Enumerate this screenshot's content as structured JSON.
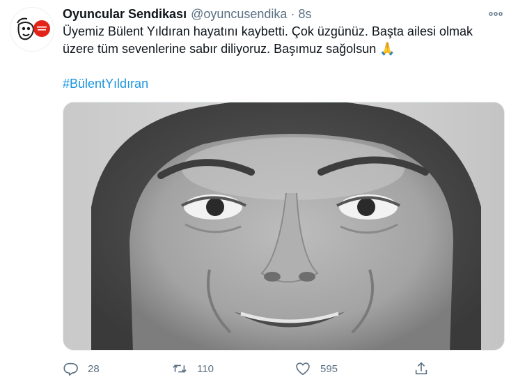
{
  "tweet": {
    "display_name": "Oyuncular Sendikası",
    "handle": "@oyuncusendika",
    "separator": "·",
    "time": "8s",
    "text_line1": "Üyemiz Bülent Yıldıran hayatını kaybetti. Çok üzgünüz. Başta ailesi olmak",
    "text_line2": "üzere tüm sevenlerine sabır diliyoruz. Başımuz sağolsun 🙏",
    "hashtag": "#BülentYıldıran"
  },
  "actions": {
    "replies": "28",
    "retweets": "110",
    "likes": "595"
  },
  "colors": {
    "link": "#1b95e0",
    "muted": "#5b7083",
    "brand_red": "#e2231a"
  },
  "icons": [
    "more-icon",
    "reply-icon",
    "retweet-icon",
    "like-icon",
    "share-icon"
  ]
}
